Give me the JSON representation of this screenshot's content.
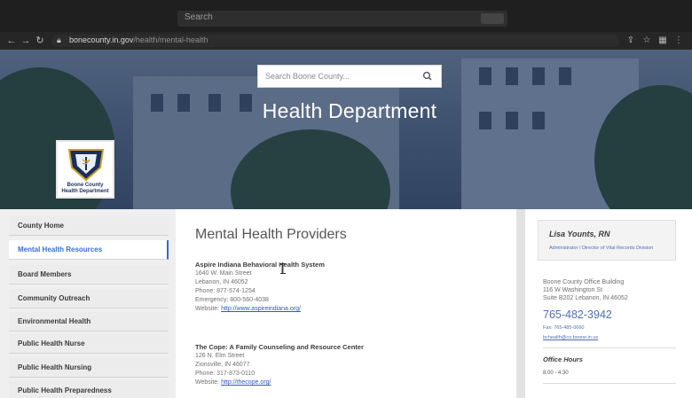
{
  "browser": {
    "search_text": "Search",
    "url_host": "bonecounty.in.gov",
    "url_path": "/health/mental-health"
  },
  "hero": {
    "search_placeholder": "Search Boone County...",
    "title": "Health Department",
    "logo_line1": "Boone County",
    "logo_line2": "Health Department"
  },
  "sidebar": {
    "items": [
      {
        "label": "County Home"
      },
      {
        "label": "Mental Health Resources"
      },
      {
        "label": "Board Members"
      },
      {
        "label": "Community Outreach"
      },
      {
        "label": "Environmental Health"
      },
      {
        "label": "Public Health Nurse"
      },
      {
        "label": "Public Health Nursing"
      },
      {
        "label": "Public Health Preparedness"
      }
    ]
  },
  "main": {
    "title": "Mental Health Providers",
    "providers": [
      {
        "name": "Aspire Indiana Behavioral Health System",
        "address1": "1640 W. Main Street",
        "address2": "Lebanon, IN 46052",
        "phone": "Phone: 877-574-1254",
        "emergency": "Emergency: 800-560-4038",
        "website_label": "Website:",
        "website": "http://www.aspireindiana.org/"
      },
      {
        "name": "The Cope: A Family Counseling and Resource Center",
        "address1": "126 N. Elm Street",
        "address2": "Zionsville, IN 46077",
        "phone": "Phone: 317-873-0110",
        "website_label": "Website:",
        "website": "http://thecope.org/"
      }
    ]
  },
  "aside": {
    "contact_name": "Lisa Younts, RN",
    "contact_title": "Administrator / Director of Vital Records Division",
    "address_lines": [
      "Boone County Office Building",
      "116 W Washington St",
      "Suite B202 Lebanon, IN 46052"
    ],
    "phone": "765-482-3942",
    "fax": "Fax: 765-485-0660",
    "email": "bchealth@co.boone.in.us",
    "hours_heading": "Office Hours",
    "hours": "8:00 - 4:30"
  },
  "colors": {
    "accent": "#2f6fc4",
    "link": "#2b5bc6",
    "phone": "#4d6fb6",
    "browser_chrome": "#1f1f1f"
  }
}
